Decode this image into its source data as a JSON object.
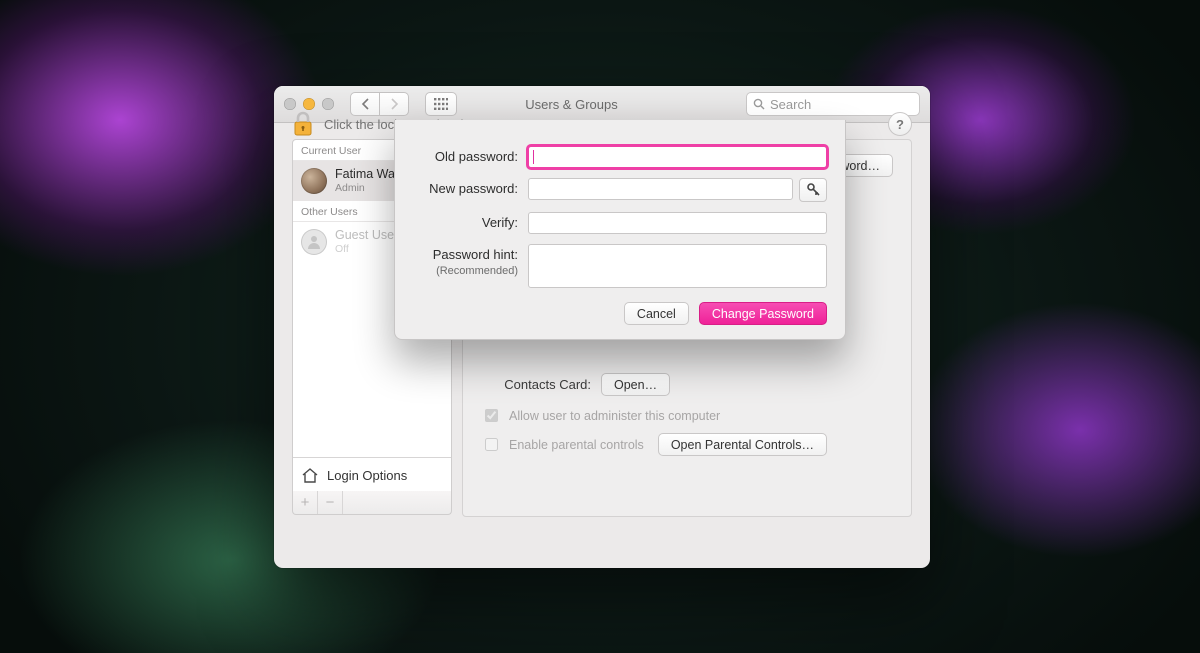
{
  "window": {
    "title": "Users & Groups",
    "search_placeholder": "Search"
  },
  "sidebar": {
    "current_header": "Current User",
    "other_header": "Other Users",
    "current": {
      "name": "Fatima Wah",
      "role": "Admin"
    },
    "guest": {
      "name": "Guest User",
      "role": "Off"
    },
    "login_options": "Login Options"
  },
  "panel": {
    "change_password_btn": "Password…",
    "contacts_label": "Contacts Card:",
    "contacts_open": "Open…",
    "admin_check": "Allow user to administer this computer",
    "parental_check": "Enable parental controls",
    "parental_btn": "Open Parental Controls…"
  },
  "sheet": {
    "old_label": "Old password:",
    "new_label": "New password:",
    "verify_label": "Verify:",
    "hint_label": "Password hint:",
    "hint_sub": "(Recommended)",
    "cancel": "Cancel",
    "change": "Change Password"
  },
  "footer": {
    "lock_text": "Click the lock to make changes."
  }
}
